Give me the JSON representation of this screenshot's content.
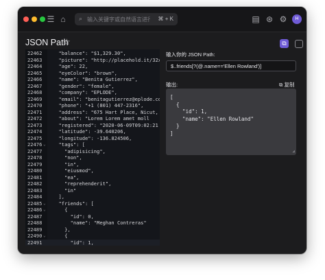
{
  "toolbar": {
    "search_placeholder": "输入关键字或自然语言进行...",
    "shortcut": "⌘ + K",
    "avatar_initial": "H"
  },
  "page": {
    "title": "JSON Path"
  },
  "editor": {
    "lines": [
      {
        "n": "22462",
        "code": "  \"balance\": \"$1,329.30\","
      },
      {
        "n": "22463",
        "code": "  \"picture\": \"http://placehold.it/32x3"
      },
      {
        "n": "22464",
        "code": "  \"age\": 22,"
      },
      {
        "n": "22465",
        "code": "  \"eyeColor\": \"brown\","
      },
      {
        "n": "22466",
        "code": "  \"name\": \"Benita Gutierrez\","
      },
      {
        "n": "22467",
        "code": "  \"gender\": \"female\","
      },
      {
        "n": "22468",
        "code": "  \"company\": \"EPLODE\","
      },
      {
        "n": "22469",
        "code": "  \"email\": \"benitagutierrez@eplode.com"
      },
      {
        "n": "22470",
        "code": "  \"phone\": \"+1 (801) 447-2316\","
      },
      {
        "n": "22471",
        "code": "  \"address\": \"675 Hart Place, Nicut, M"
      },
      {
        "n": "22472",
        "code": "  \"about\": \"Lorem Lorem amet moll"
      },
      {
        "n": "22473",
        "code": "  \"registered\": \"2020-06-09T09:02:21 -"
      },
      {
        "n": "22474",
        "code": "  \"latitude\": -39.640206,"
      },
      {
        "n": "22475",
        "code": "  \"longitude\": -136.824506,"
      },
      {
        "n": "22476",
        "code": "  \"tags\": [",
        "fold": true
      },
      {
        "n": "22477",
        "code": "    \"adipisicing\","
      },
      {
        "n": "22478",
        "code": "    \"non\","
      },
      {
        "n": "22479",
        "code": "    \"in\","
      },
      {
        "n": "22480",
        "code": "    \"eiusmod\","
      },
      {
        "n": "22481",
        "code": "    \"ea\","
      },
      {
        "n": "22482",
        "code": "    \"reprehenderit\","
      },
      {
        "n": "22483",
        "code": "    \"in\""
      },
      {
        "n": "22484",
        "code": "  ],"
      },
      {
        "n": "22485",
        "code": "  \"friends\": [",
        "fold": true
      },
      {
        "n": "22486",
        "code": "    {",
        "fold": true
      },
      {
        "n": "22487",
        "code": "      \"id\": 0,"
      },
      {
        "n": "22488",
        "code": "      \"name\": \"Meghan Contreras\""
      },
      {
        "n": "22489",
        "code": "    },"
      },
      {
        "n": "22490",
        "code": "    {",
        "fold": true
      },
      {
        "n": "22491",
        "code": "      \"id\": 1,"
      }
    ]
  },
  "jsonpath": {
    "input_label": "输入你的 JSON Path:",
    "input_value": "$..friends[?(@.name=='Ellen Rowland')]",
    "output_label": "输出:",
    "copy_label": "复制",
    "output_lines": [
      "[",
      "  {",
      "    \"id\": 1,",
      "    \"name\": \"Ellen Rowland\"",
      "  }",
      "]"
    ]
  }
}
